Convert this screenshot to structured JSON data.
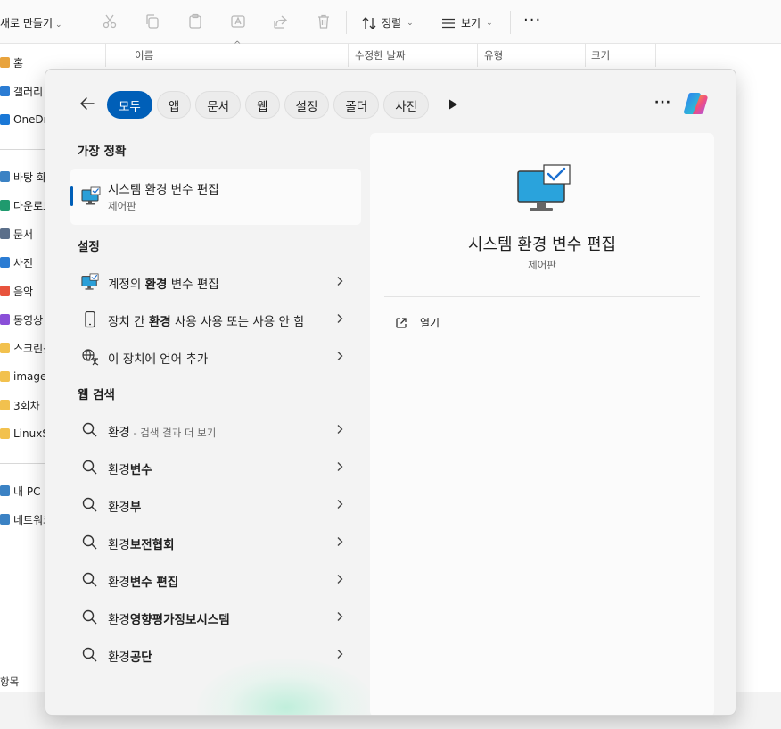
{
  "explorer": {
    "toolbar": {
      "new_label": "새로 만들기",
      "sort_label": "정렬",
      "view_label": "보기",
      "more_label": "···"
    },
    "columns": {
      "name": "이름",
      "date": "수정한 날짜",
      "type": "유형",
      "size": "크기"
    },
    "nav": [
      {
        "label": "홈",
        "color": "#e8a33d"
      },
      {
        "label": "갤러리",
        "color": "#2b7cd3"
      },
      {
        "label": "OneDrive",
        "color": "#1a78d6"
      },
      {
        "label": "바탕 화면",
        "color": "#3b82c4"
      },
      {
        "label": "다운로드",
        "color": "#1f9a6e"
      },
      {
        "label": "문서",
        "color": "#5b6f8a"
      },
      {
        "label": "사진",
        "color": "#2b7cd3"
      },
      {
        "label": "음악",
        "color": "#e8533d"
      },
      {
        "label": "동영상",
        "color": "#8a4fd8"
      },
      {
        "label": "스크린샷",
        "color": "#f2c14e"
      },
      {
        "label": "images",
        "color": "#f2c14e"
      },
      {
        "label": "3회차",
        "color": "#f2c14e"
      },
      {
        "label": "LinuxSystem",
        "color": "#f2c14e"
      },
      {
        "label": "내 PC",
        "color": "#3b82c4"
      },
      {
        "label": "네트워크",
        "color": "#3b82c4"
      }
    ],
    "status": "항목"
  },
  "search": {
    "filters": [
      "모두",
      "앱",
      "문서",
      "웹",
      "설정",
      "폴더",
      "사진"
    ],
    "active_filter": "모두",
    "best_match_header": "가장 정확",
    "best_match": {
      "title": "시스템 환경 변수 편집",
      "subtitle": "제어판"
    },
    "settings_header": "설정",
    "settings": [
      {
        "pre": "계정의 ",
        "bold": "환경",
        "post": " 변수 편집",
        "icon": "monitor-check-icon"
      },
      {
        "pre": "장치 간 ",
        "bold": "환경",
        "post": " 사용 사용 또는 사용 안 함",
        "icon": "phone-icon"
      },
      {
        "pre": "",
        "bold": "",
        "post": "이 장치에 언어 추가",
        "icon": "language-icon"
      }
    ],
    "web_header": "웹 검색",
    "web": [
      {
        "base": "환경",
        "bold": "",
        "suffix": " - 검색 결과 더 보기"
      },
      {
        "base": "환경",
        "bold": "변수",
        "suffix": ""
      },
      {
        "base": "환경",
        "bold": "부",
        "suffix": ""
      },
      {
        "base": "환경",
        "bold": "보전협회",
        "suffix": ""
      },
      {
        "base": "환경",
        "bold": "변수 편집",
        "suffix": ""
      },
      {
        "base": "환경",
        "bold": "영향평가정보시스템",
        "suffix": ""
      },
      {
        "base": "환경",
        "bold": "공단",
        "suffix": ""
      }
    ],
    "preview": {
      "title": "시스템 환경 변수 편집",
      "subtitle": "제어판",
      "open_label": "열기"
    },
    "more_label": "···"
  },
  "colors": {
    "accent": "#005fb8",
    "popup_bg": "#f3f3f3",
    "card_bg": "#fbfbfb"
  }
}
